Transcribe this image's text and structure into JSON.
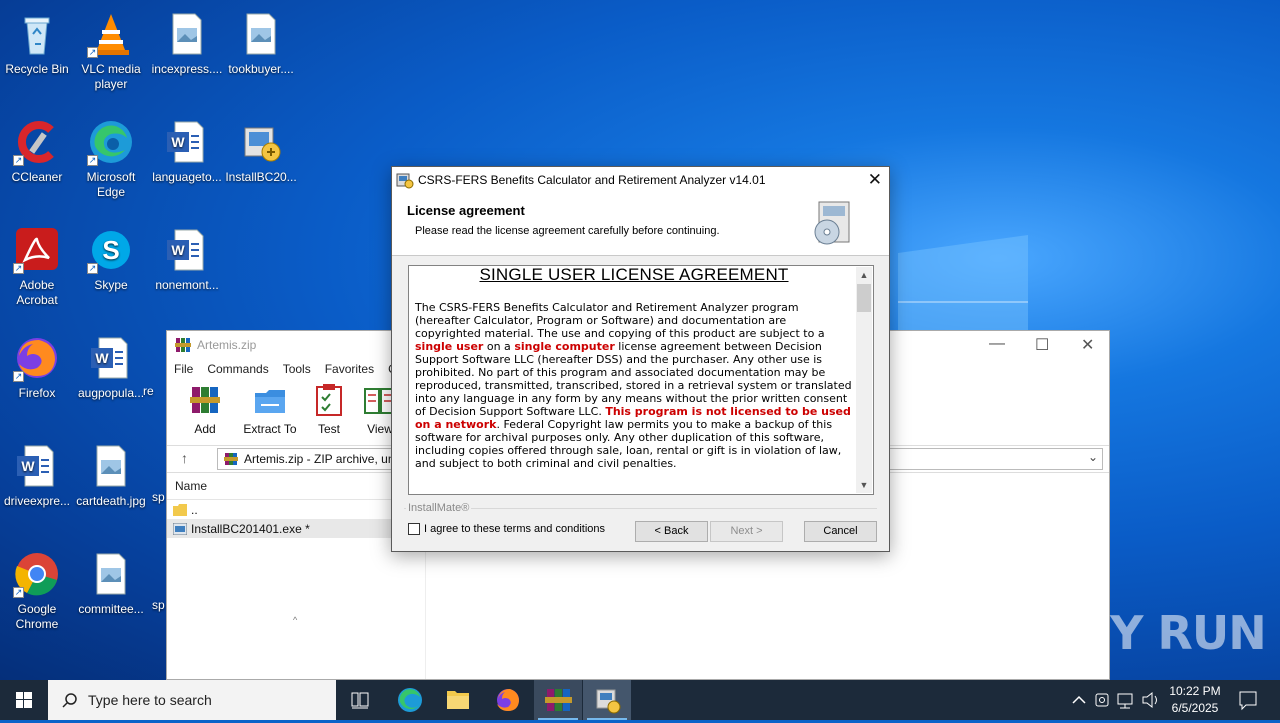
{
  "desktop": {
    "icons": [
      {
        "label": "Recycle Bin"
      },
      {
        "label": "VLC media player"
      },
      {
        "label": "incexpress...."
      },
      {
        "label": "tookbuyer...."
      },
      {
        "label": "CCleaner"
      },
      {
        "label": "Microsoft Edge"
      },
      {
        "label": "languageto..."
      },
      {
        "label": "InstallBC20..."
      },
      {
        "label": "Adobe Acrobat"
      },
      {
        "label": "Skype"
      },
      {
        "label": "nonemont..."
      },
      {
        "label": "Firefox"
      },
      {
        "label": "augpopula..."
      },
      {
        "label": "re"
      },
      {
        "label": "driveexpre..."
      },
      {
        "label": "cartdeath.jpg"
      },
      {
        "label": "sp"
      },
      {
        "label": "Google Chrome"
      },
      {
        "label": "committee..."
      },
      {
        "label": "sp"
      }
    ]
  },
  "winrar": {
    "title": "Artemis.zip",
    "menu": [
      "File",
      "Commands",
      "Tools",
      "Favorites",
      "O"
    ],
    "toolbar": [
      "Add",
      "Extract To",
      "Test",
      "View"
    ],
    "address": "Artemis.zip - ZIP archive, un",
    "column_name": "Name",
    "rows": [
      "..",
      "InstallBC201401.exe *"
    ]
  },
  "installer": {
    "title": "CSRS-FERS Benefits Calculator and Retirement Analyzer v14.01",
    "header_title": "License agreement",
    "header_subtitle": "Please read the license agreement carefully before continuing.",
    "license": {
      "heading": "SINGLE USER LICENSE AGREEMENT",
      "p1": "The CSRS-FERS Benefits Calculator and Retirement Analyzer program (hereafter Calculator, Program or Software) and documentation are copyrighted material. The use and copying of this product are subject to a",
      "r1": "single user",
      "p2": "on a",
      "r2": "single computer",
      "p3": "license agreement between Decision Support Software LLC (hereafter DSS) and the purchaser. Any other use is prohibited. No part of this program and associated documentation may be reproduced, transmitted, transcribed, stored in a retrieval system or translated into any language in any form by any means without the prior written consent of Decision Support Software LLC.",
      "r3": "This program is not licensed to be used on a network",
      "p4": ". Federal Copyright law permits you to make a backup of this software for archival purposes only. Any other duplication of this software, including copies offered through sale, loan, rental or gift is in violation of law, and subject to both criminal and civil penalties."
    },
    "brand": "InstallMate®",
    "agree_label": "I agree to these terms and conditions",
    "agree_checked": false,
    "back_label": "< Back",
    "next_label": "Next >",
    "cancel_label": "Cancel"
  },
  "taskbar": {
    "search_placeholder": "Type here to search",
    "time": "10:22 PM",
    "date": "6/5/2025"
  },
  "watermark": "ANY RUN"
}
